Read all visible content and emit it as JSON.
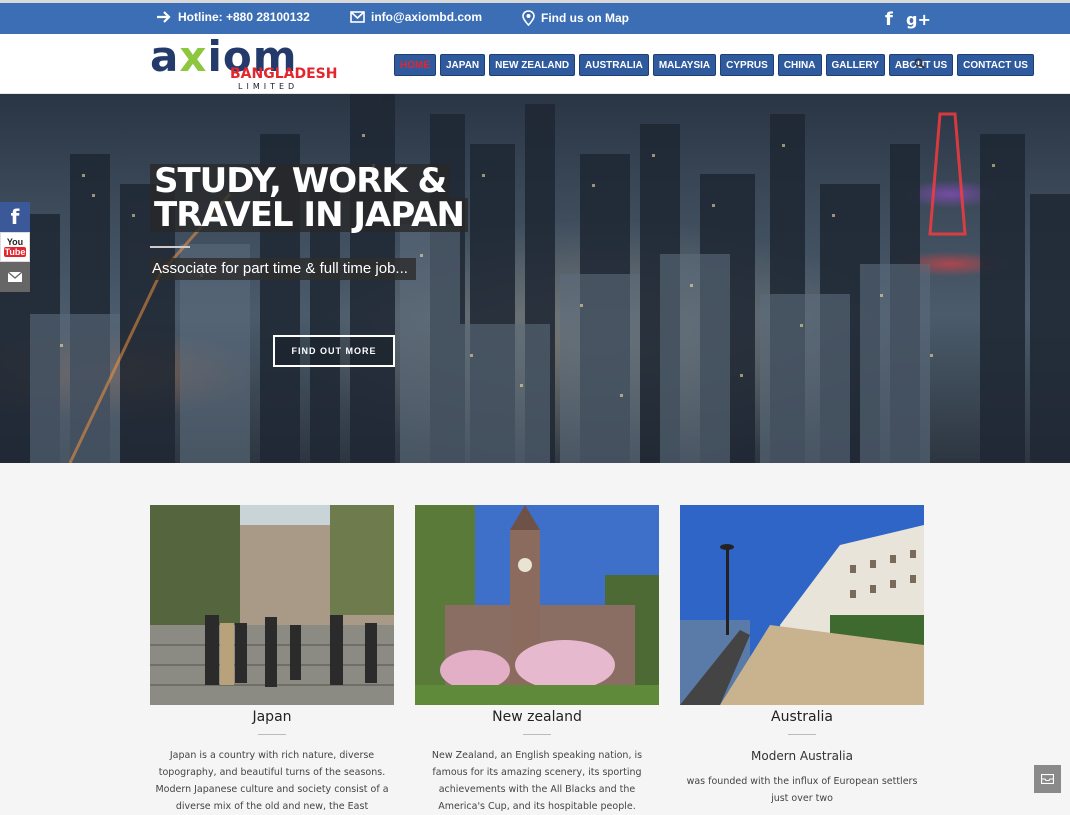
{
  "topbar": {
    "hotline": "Hotline: +880 28100132",
    "email": "info@axiombd.com",
    "map": "Find us on Map",
    "facebook": "f",
    "googleplus": "g+"
  },
  "logo": {
    "main_a": "a",
    "main_x": "x",
    "main_rest": "iom",
    "sub": "BANGLADESH",
    "ltd": "LIMITED"
  },
  "nav": {
    "items": [
      "HOME",
      "JAPAN",
      "NEW ZEALAND",
      "AUSTRALIA",
      "MALAYSIA",
      "CYPRUS",
      "CHINA",
      "GALLERY",
      "ABOUT US",
      "CONTACT US"
    ]
  },
  "side": {
    "facebook": "f",
    "youtube_top": "You",
    "youtube_bottom": "Tube"
  },
  "hero": {
    "title_line1": "STUDY, WORK &",
    "title_line2": "TRAVEL IN JAPAN",
    "subtitle": "Associate for part time & full time job...",
    "button": "FIND OUT MORE"
  },
  "cards": [
    {
      "title": "Japan",
      "text": "Japan is a country with rich nature, diverse topography, and beautiful turns of the seasons. Modern Japanese culture and society consist of a diverse mix of the old and new, the East"
    },
    {
      "title": "New zealand",
      "text": "New Zealand, an English speaking nation, is famous for its amazing scenery, its sporting achievements with the All Blacks and the America's Cup, and its hospitable people."
    },
    {
      "title": "Australia",
      "subtitle": "Modern Australia",
      "text": "was founded with the influx of European settlers just over two"
    }
  ],
  "colors": {
    "topbar": "#3b6eb5",
    "nav": "#2f5a9e",
    "accent_red": "#e3262d",
    "logo_green": "#8dc63f"
  }
}
